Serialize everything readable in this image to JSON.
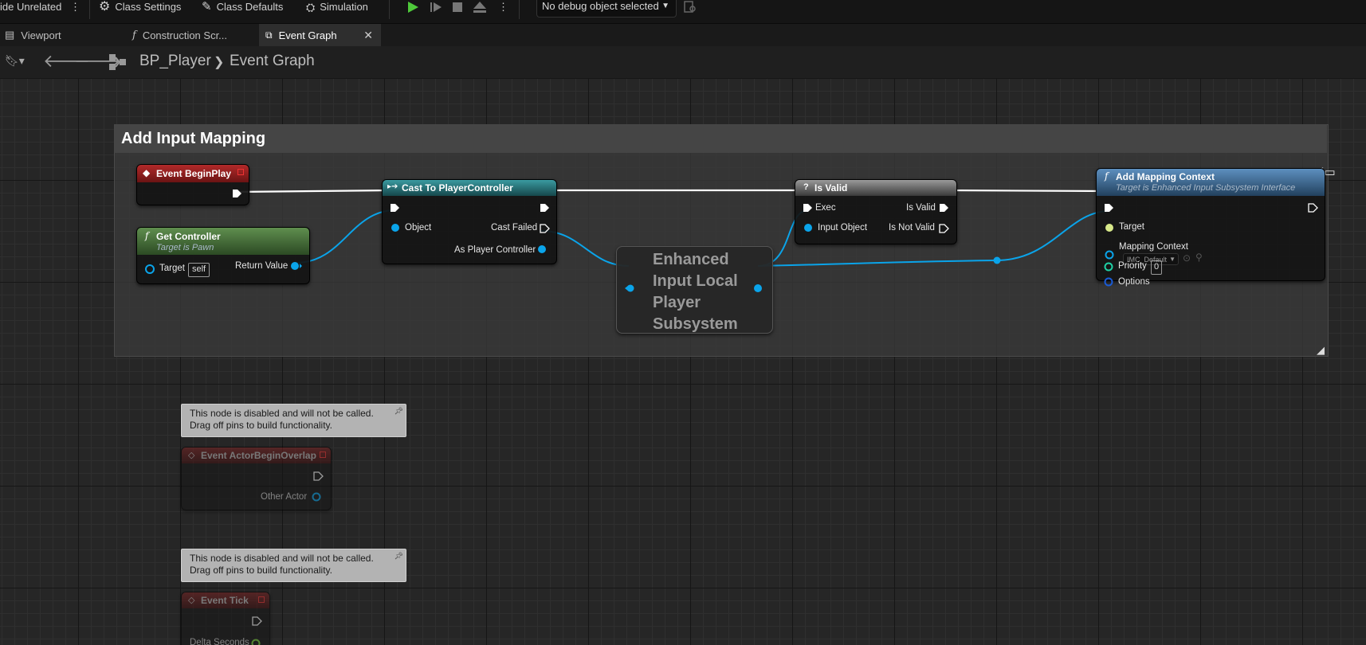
{
  "toolbar": {
    "hide_unrelated": "ide Unrelated",
    "class_settings": "Class Settings",
    "class_defaults": "Class Defaults",
    "simulation": "Simulation",
    "debug_object": "No debug object selected"
  },
  "tabs": [
    {
      "label": "Viewport",
      "icon": "viewport-icon"
    },
    {
      "label": "Construction Scr...",
      "icon": "function-icon"
    },
    {
      "label": "Event Graph",
      "icon": "graph-icon"
    }
  ],
  "breadcrumb": {
    "blueprint": "BP_Player",
    "graph": "Event Graph"
  },
  "comment": {
    "title": "Add Input Mapping"
  },
  "nodes": {
    "begin_play": {
      "title": "Event BeginPlay"
    },
    "get_controller": {
      "title": "Get Controller",
      "subtitle": "Target is Pawn",
      "target_label": "Target",
      "target_default": "self",
      "return_label": "Return Value"
    },
    "cast": {
      "title": "Cast To PlayerController",
      "object_label": "Object",
      "cast_failed_label": "Cast Failed",
      "as_pc_label": "As Player Controller"
    },
    "subsystem": {
      "title": "Enhanced Input Local Player Subsystem"
    },
    "is_valid": {
      "title": "Is Valid",
      "exec_label": "Exec",
      "input_object_label": "Input Object",
      "is_valid_label": "Is Valid",
      "is_not_valid_label": "Is Not Valid"
    },
    "add_mapping": {
      "title": "Add Mapping Context",
      "subtitle": "Target is Enhanced Input Subsystem Interface",
      "target_label": "Target",
      "mapping_context_label": "Mapping Context",
      "mapping_context_value": "IMC_Default",
      "priority_label": "Priority",
      "priority_value": "0",
      "options_label": "Options"
    },
    "overlap": {
      "title": "Event ActorBeginOverlap",
      "other_actor_label": "Other Actor"
    },
    "tick": {
      "title": "Event Tick",
      "delta_label": "Delta Seconds"
    }
  },
  "disabled_tooltip": {
    "line1": "This node is disabled and will not be called.",
    "line2": "Drag off pins to build functionality."
  },
  "colors": {
    "exec_wire": "#ffffff",
    "object_wire": "#0aa4ea",
    "event_header": "#8a1c1c",
    "pure_header": "#4d7a3f",
    "cast_header": "#2a7a80",
    "function_header": "#3b6e98"
  }
}
